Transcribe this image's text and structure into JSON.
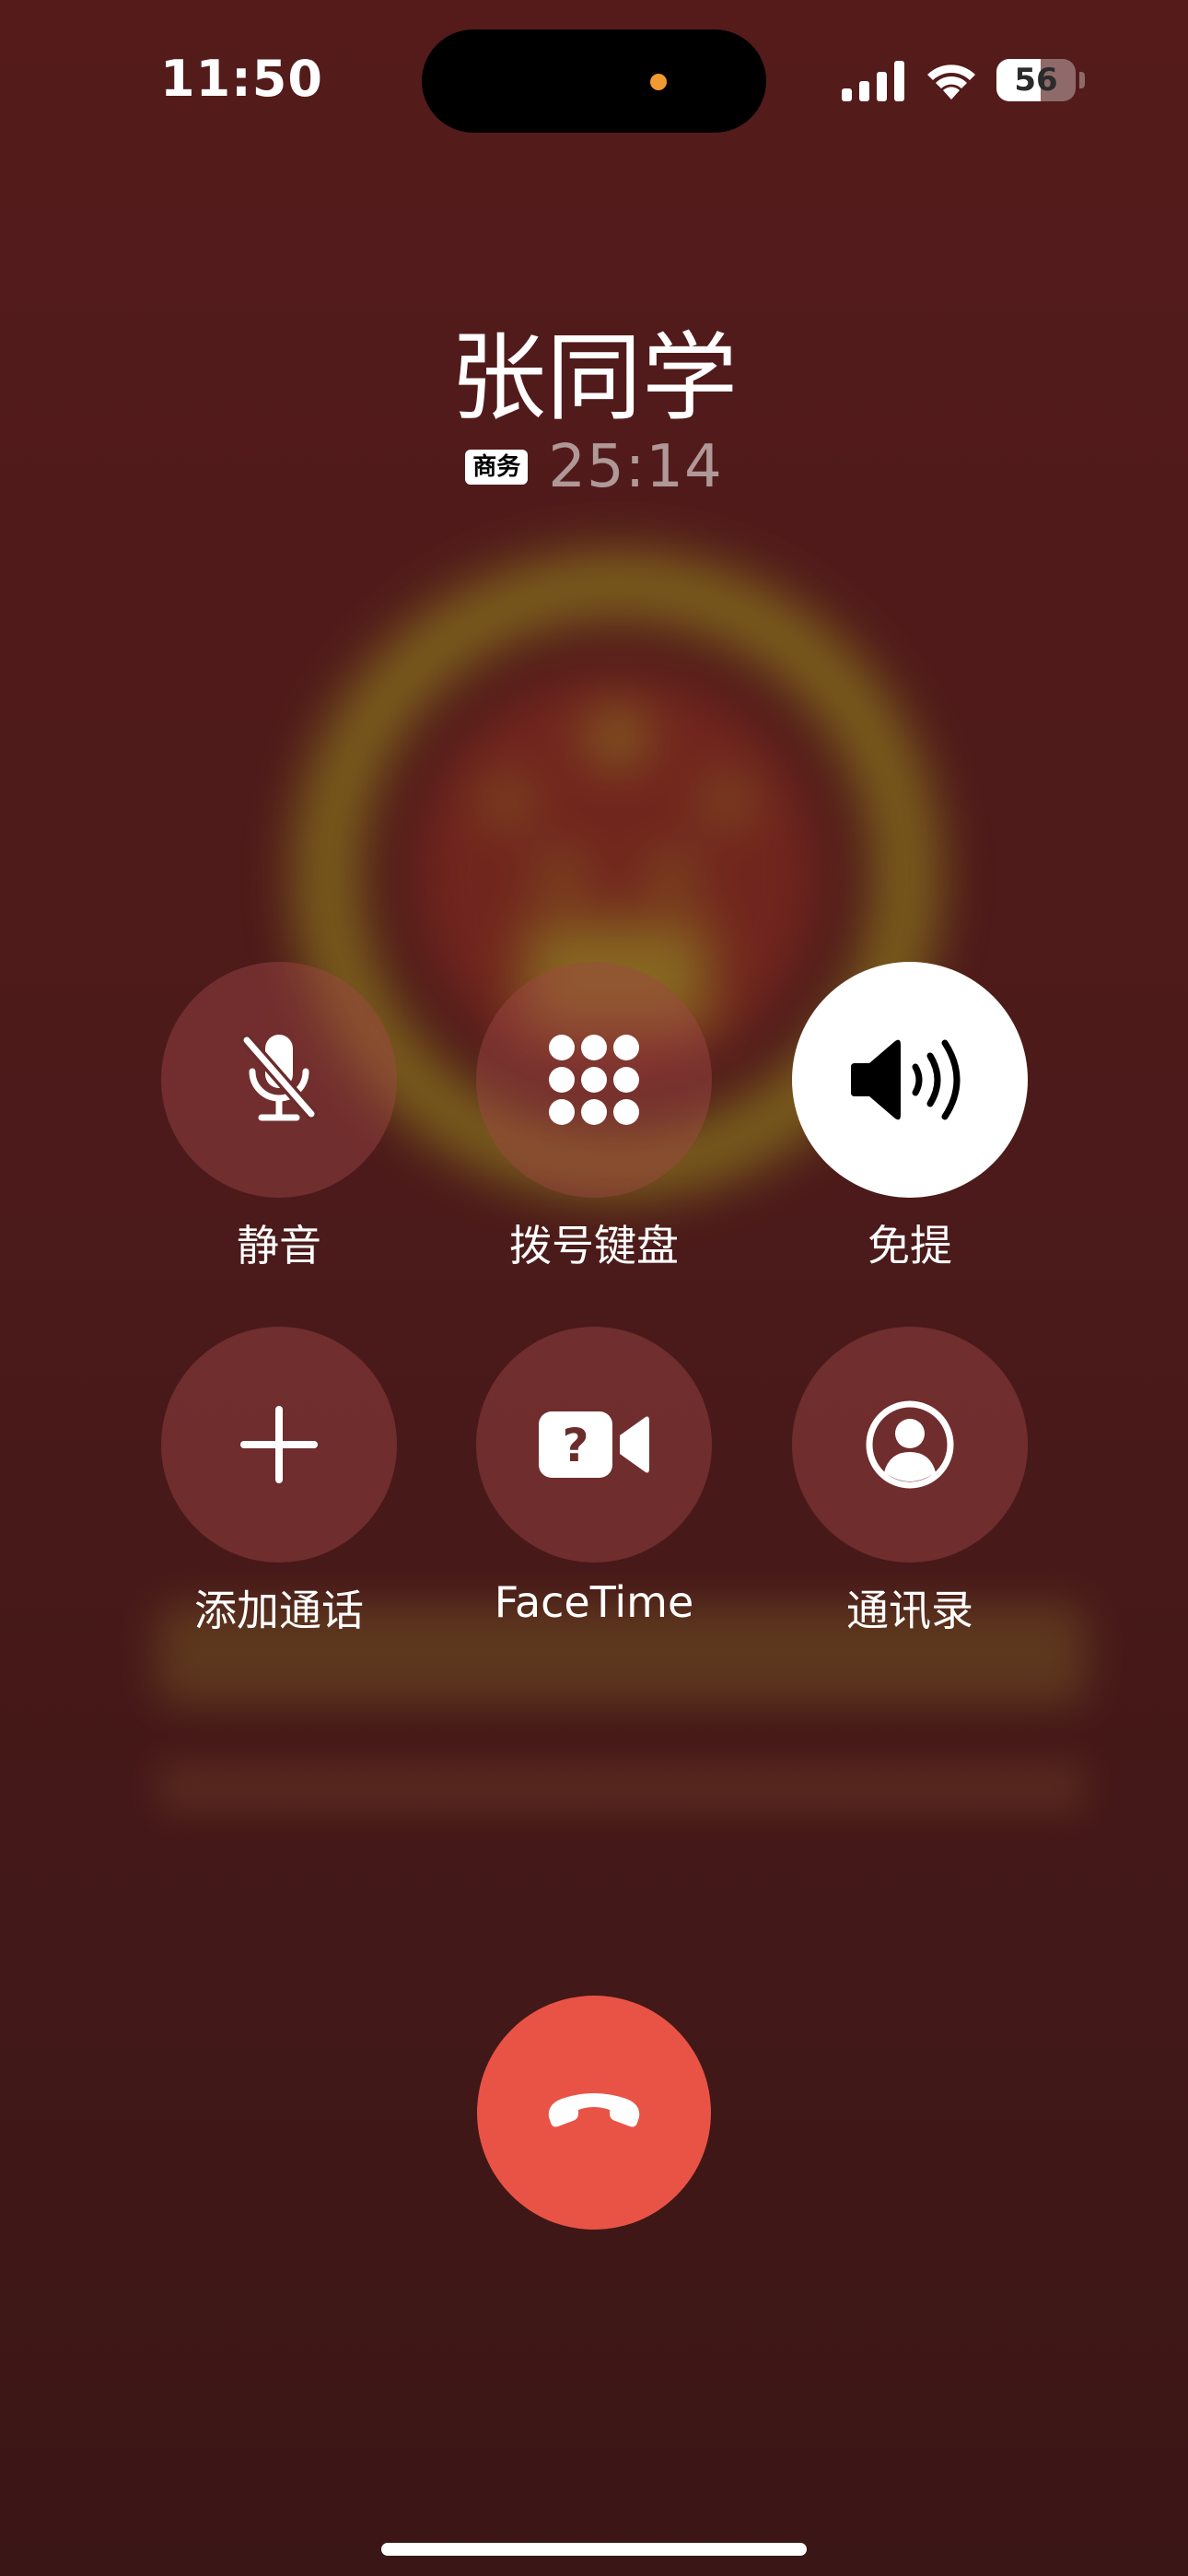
{
  "status_bar": {
    "time": "11:50",
    "battery_percent": "56",
    "battery_level": 0.56,
    "signal_bars": 4
  },
  "caller": {
    "name": "张同学",
    "label": "商务",
    "duration": "25:14"
  },
  "controls": [
    {
      "label": "静音",
      "icon": "mic-slash-icon",
      "active": false
    },
    {
      "label": "拨号键盘",
      "icon": "keypad-icon",
      "active": false
    },
    {
      "label": "免提",
      "icon": "speaker-icon",
      "active": true
    },
    {
      "label": "添加通话",
      "icon": "plus-icon",
      "active": false
    },
    {
      "label": "FaceTime",
      "icon": "facetime-icon",
      "active": false
    },
    {
      "label": "通讯录",
      "icon": "contacts-icon",
      "active": false
    }
  ],
  "end_call": {
    "icon": "phone-down-icon"
  },
  "colors": {
    "background": "#4c1a1a",
    "end_call": "#e95345",
    "button": "#a04646",
    "island_dot": "#f29a32"
  }
}
